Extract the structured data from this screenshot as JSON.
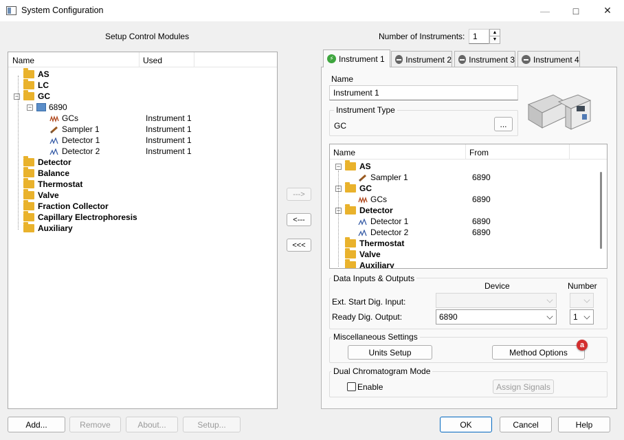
{
  "window": {
    "title": "System Configuration",
    "minimize": "—",
    "maximize": "□",
    "close": "✕"
  },
  "left": {
    "heading": "Setup Control Modules",
    "columns": [
      "Name",
      "Used"
    ],
    "tree": [
      {
        "label": "AS",
        "bold": true,
        "icon": "folder-icon",
        "used": ""
      },
      {
        "label": "LC",
        "bold": true,
        "icon": "folder-icon",
        "used": ""
      },
      {
        "label": "GC",
        "bold": true,
        "icon": "folder-icon",
        "used": "",
        "expanded": true
      },
      {
        "label": "6890",
        "bold": false,
        "icon": "gc-module-icon",
        "used": "",
        "expanded": true
      },
      {
        "label": "GCs",
        "bold": false,
        "icon": "gc-wave-icon",
        "used": "Instrument 1"
      },
      {
        "label": "Sampler 1",
        "bold": false,
        "icon": "sampler-icon",
        "used": "Instrument 1"
      },
      {
        "label": "Detector 1",
        "bold": false,
        "icon": "detector-wave-icon",
        "used": "Instrument 1"
      },
      {
        "label": "Detector 2",
        "bold": false,
        "icon": "detector-wave-icon",
        "used": "Instrument 1"
      },
      {
        "label": "Detector",
        "bold": true,
        "icon": "folder-icon",
        "used": ""
      },
      {
        "label": "Balance",
        "bold": true,
        "icon": "folder-icon",
        "used": ""
      },
      {
        "label": "Thermostat",
        "bold": true,
        "icon": "folder-icon",
        "used": ""
      },
      {
        "label": "Valve",
        "bold": true,
        "icon": "folder-icon",
        "used": ""
      },
      {
        "label": "Fraction Collector",
        "bold": true,
        "icon": "folder-icon",
        "used": ""
      },
      {
        "label": "Capillary Electrophoresis",
        "bold": true,
        "icon": "folder-icon",
        "used": ""
      },
      {
        "label": "Auxiliary",
        "bold": true,
        "icon": "folder-icon",
        "used": ""
      }
    ]
  },
  "transfer": {
    "add": "--->",
    "remove": "<---",
    "remove_all": "<<<"
  },
  "instruments": {
    "count_label": "Number of Instruments:",
    "count": "1",
    "tabs": [
      "Instrument 1",
      "Instrument 2",
      "Instrument 3",
      "Instrument 4"
    ],
    "active_tab": 0
  },
  "instrument": {
    "name_label": "Name",
    "name_value": "Instrument 1",
    "type_label": "Instrument Type",
    "type_value": "GC",
    "type_button": "...",
    "columns": [
      "Name",
      "From"
    ],
    "tree": [
      {
        "label": "AS",
        "bold": true,
        "icon": "folder-icon",
        "from": ""
      },
      {
        "label": "Sampler 1",
        "bold": false,
        "icon": "sampler-icon",
        "from": "6890"
      },
      {
        "label": "GC",
        "bold": true,
        "icon": "folder-icon",
        "from": ""
      },
      {
        "label": "GCs",
        "bold": false,
        "icon": "gc-wave-icon",
        "from": "6890"
      },
      {
        "label": "Detector",
        "bold": true,
        "icon": "folder-icon",
        "from": ""
      },
      {
        "label": "Detector 1",
        "bold": false,
        "icon": "detector-wave-icon",
        "from": "6890"
      },
      {
        "label": "Detector 2",
        "bold": false,
        "icon": "detector-wave-icon",
        "from": "6890"
      },
      {
        "label": "Thermostat",
        "bold": true,
        "icon": "folder-icon",
        "from": ""
      },
      {
        "label": "Valve",
        "bold": true,
        "icon": "folder-icon",
        "from": ""
      },
      {
        "label": "Auxiliary",
        "bold": true,
        "icon": "folder-icon",
        "from": ""
      }
    ]
  },
  "io": {
    "group_label": "Data Inputs & Outputs",
    "device_header": "Device",
    "number_header": "Number",
    "ext_start_label": "Ext. Start Dig. Input:",
    "ext_start_device": "",
    "ext_start_number": "",
    "ready_label": "Ready Dig. Output:",
    "ready_device": "6890",
    "ready_number": "1"
  },
  "misc": {
    "group_label": "Miscellaneous Settings",
    "units_button": "Units Setup",
    "method_button": "Method Options",
    "badge": "a"
  },
  "dual": {
    "group_label": "Dual Chromatogram Mode",
    "enable_label": "Enable",
    "enable_checked": false,
    "assign_button": "Assign Signals"
  },
  "footer": {
    "add": "Add...",
    "remove": "Remove",
    "about": "About...",
    "setup": "Setup...",
    "ok": "OK",
    "cancel": "Cancel",
    "help": "Help"
  }
}
